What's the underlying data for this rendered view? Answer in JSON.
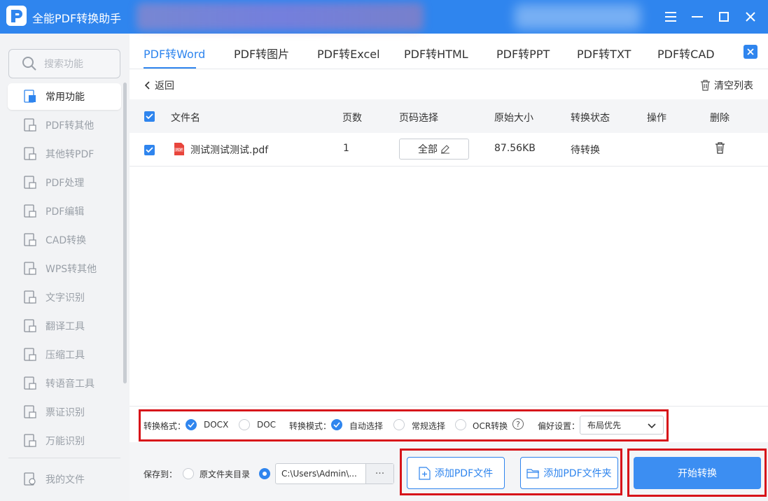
{
  "app": {
    "title": "全能PDF转换助手"
  },
  "window": {
    "menu": "☰",
    "minimize": "—",
    "maximize": "☐",
    "close": "✕"
  },
  "sidebar": {
    "search_placeholder": "搜索功能",
    "items": [
      {
        "label": "常用功能",
        "icon": "star-doc-icon",
        "active": true
      },
      {
        "label": "PDF转其他",
        "icon": "pdf-export-icon"
      },
      {
        "label": "其他转PDF",
        "icon": "pdf-import-icon"
      },
      {
        "label": "PDF处理",
        "icon": "pdf-process-icon"
      },
      {
        "label": "PDF编辑",
        "icon": "pdf-edit-icon"
      },
      {
        "label": "CAD转换",
        "icon": "cad-icon"
      },
      {
        "label": "WPS转其他",
        "icon": "wps-icon"
      },
      {
        "label": "文字识别",
        "icon": "text-recognition-icon"
      },
      {
        "label": "翻译工具",
        "icon": "translate-icon"
      },
      {
        "label": "压缩工具",
        "icon": "compress-icon"
      },
      {
        "label": "转语音工具",
        "icon": "speech-icon"
      },
      {
        "label": "票证识别",
        "icon": "ticket-icon"
      },
      {
        "label": "万能识别",
        "icon": "camera-icon"
      }
    ],
    "my_files": "我的文件"
  },
  "tabs": [
    "PDF转Word",
    "PDF转图片",
    "PDF转Excel",
    "PDF转HTML",
    "PDF转PPT",
    "PDF转TXT",
    "PDF转CAD"
  ],
  "toolbar": {
    "back": "返回",
    "clear": "清空列表"
  },
  "table": {
    "headers": [
      "文件名",
      "页数",
      "页码选择",
      "原始大小",
      "转换状态",
      "操作",
      "删除"
    ],
    "rows": [
      {
        "name": "测试测试测试.pdf",
        "pages": "1",
        "page_select": "全部",
        "size": "87.56KB",
        "status": "待转换"
      }
    ]
  },
  "options": {
    "format_label": "转换格式：",
    "format_docx": "DOCX",
    "format_doc": "DOC",
    "mode_label": "转换模式：",
    "mode_auto": "自动选择",
    "mode_normal": "常规选择",
    "mode_ocr": "OCR转换",
    "pref_label": "偏好设置：",
    "pref_value": "布局优先"
  },
  "bottom": {
    "save_label": "保存到：",
    "source_dir": "原文件夹目录",
    "path": "C:\\Users\\Admin\\...",
    "path_dots": "···",
    "add_file": "添加PDF文件",
    "add_folder": "添加PDF文件夹",
    "start": "开始转换"
  },
  "colors": {
    "accent": "#2f85ee",
    "highlight": "#d7141a"
  }
}
